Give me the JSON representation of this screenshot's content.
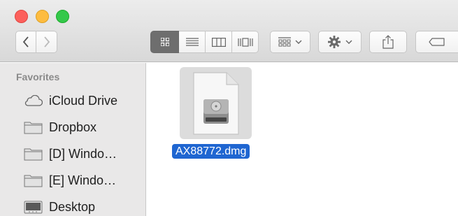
{
  "sidebar": {
    "heading": "Favorites",
    "items": [
      {
        "label": "iCloud Drive",
        "icon": "cloud-icon"
      },
      {
        "label": "Dropbox",
        "icon": "folder-icon"
      },
      {
        "label": "[D] Windo…",
        "icon": "folder-icon"
      },
      {
        "label": "[E] Windo…",
        "icon": "folder-icon"
      },
      {
        "label": "Desktop",
        "icon": "desktop-icon"
      }
    ]
  },
  "content": {
    "files": [
      {
        "name": "AX88772.dmg",
        "icon": "disk-image-icon",
        "selected": true
      }
    ]
  },
  "colors": {
    "selection": "#1f66d1",
    "close": "#fc605c",
    "minimize": "#fdbc40",
    "maximize": "#34c84a"
  }
}
